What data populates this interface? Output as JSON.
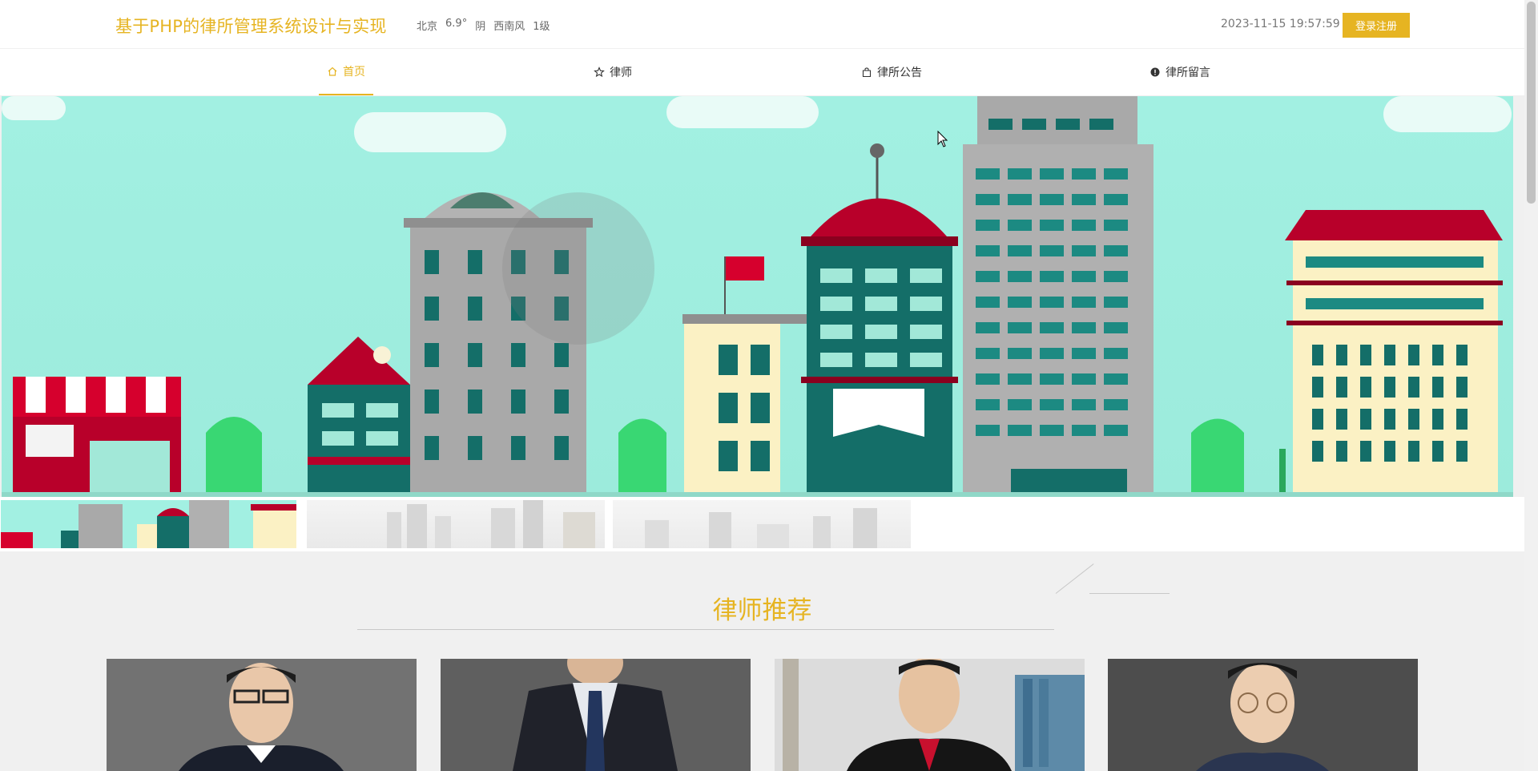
{
  "header": {
    "site_title": "基于PHP的律所管理系统设计与实现",
    "weather": {
      "city": "北京",
      "temperature": "6.9°",
      "condition": "阴",
      "wind": "西南风",
      "level": "1级"
    },
    "datetime": "2023-11-15 19:57:59",
    "login_label": "登录注册"
  },
  "nav": {
    "items": [
      {
        "label": "首页",
        "icon": "home-icon"
      },
      {
        "label": "律师",
        "icon": "star-icon"
      },
      {
        "label": "律所公告",
        "icon": "bag-icon"
      },
      {
        "label": "律所留言",
        "icon": "alert-circle-icon"
      }
    ],
    "active_index": 0
  },
  "section": {
    "title": "律师推荐"
  },
  "colors": {
    "accent": "#e6b422",
    "banner_sky": "#a2f0e2",
    "building_red": "#b8002a",
    "building_teal": "#146e68"
  }
}
